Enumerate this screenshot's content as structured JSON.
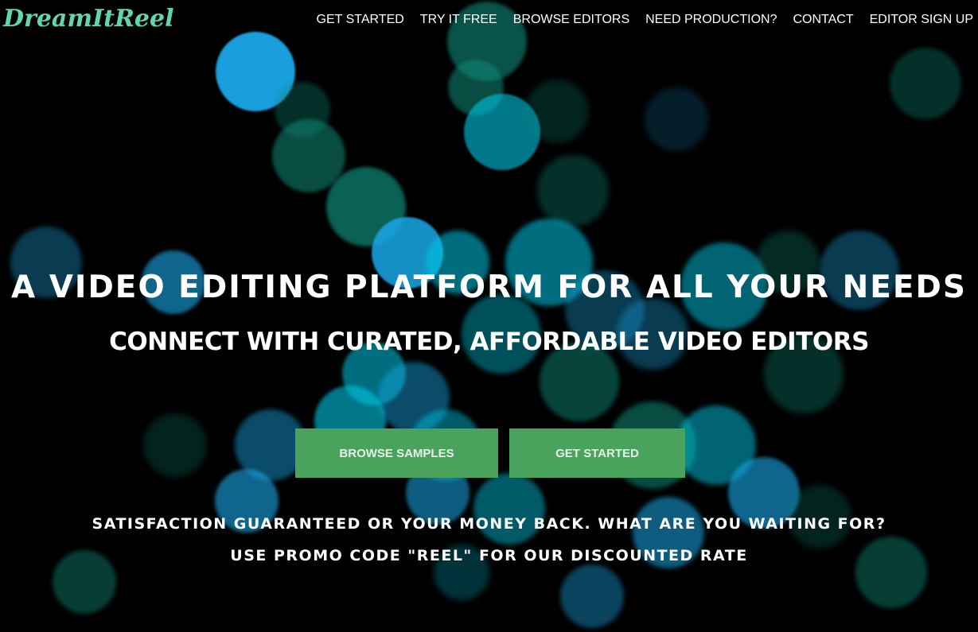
{
  "nav": {
    "logo": "DreamItReel",
    "links": [
      "GET STARTED",
      "TRY IT FREE",
      "BROWSE EDITORS",
      "NEED PRODUCTION?",
      "CONTACT",
      "EDITOR SIGN UP"
    ]
  },
  "hero": {
    "headline": "A VIDEO EDITING PLATFORM FOR ALL YOUR NEEDS",
    "subheadline": "CONNECT WITH CURATED, AFFORDABLE VIDEO EDITORS",
    "buttons": {
      "browse_samples": "BROWSE SAMPLES",
      "get_started": "GET STARTED"
    },
    "guarantee": "SATISFACTION GUARANTEED OR YOUR MONEY BACK. WHAT ARE YOU WAITING FOR?",
    "promo": "USE PROMO CODE \"REEL\" FOR OUR DISCOUNTED RATE"
  },
  "colors": {
    "background": "#000000",
    "logo": "#5fd6b1",
    "button": "#4aa35c",
    "bokeh_cyan": "#00c8e6",
    "bokeh_blue": "#1aa8e8",
    "bokeh_teal": "#0f8a78"
  }
}
